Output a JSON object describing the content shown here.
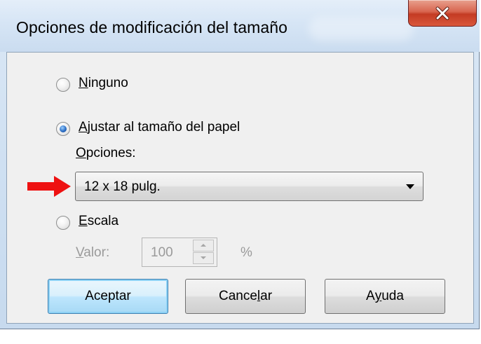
{
  "window": {
    "title": "Opciones de modificación del tamaño",
    "close_icon": "close-x-icon"
  },
  "radios": {
    "none": {
      "pre": "",
      "mnemonic": "N",
      "post": "inguno",
      "checked": false
    },
    "fit": {
      "pre": "",
      "mnemonic": "A",
      "post": "justar al tamaño del papel",
      "checked": true
    },
    "scale": {
      "pre": "",
      "mnemonic": "E",
      "post": "scala",
      "checked": false
    }
  },
  "options": {
    "label_mnemonic": "O",
    "label_rest": "pciones:",
    "selected": "12 x 18 pulg."
  },
  "scale_value": {
    "label_mnemonic": "V",
    "label_rest": "alor:",
    "value": "100",
    "unit": "%"
  },
  "buttons": {
    "ok": {
      "pre": "Aceptar",
      "mnemonic": "",
      "post": ""
    },
    "cancel": {
      "pre": "Cance",
      "mnemonic": "l",
      "post": "ar"
    },
    "help": {
      "pre": "A",
      "mnemonic": "y",
      "post": "uda"
    }
  },
  "colors": {
    "annotation_arrow": "#ee1111",
    "close_button": "#c43b23",
    "default_button_border": "#3c7fb1"
  }
}
